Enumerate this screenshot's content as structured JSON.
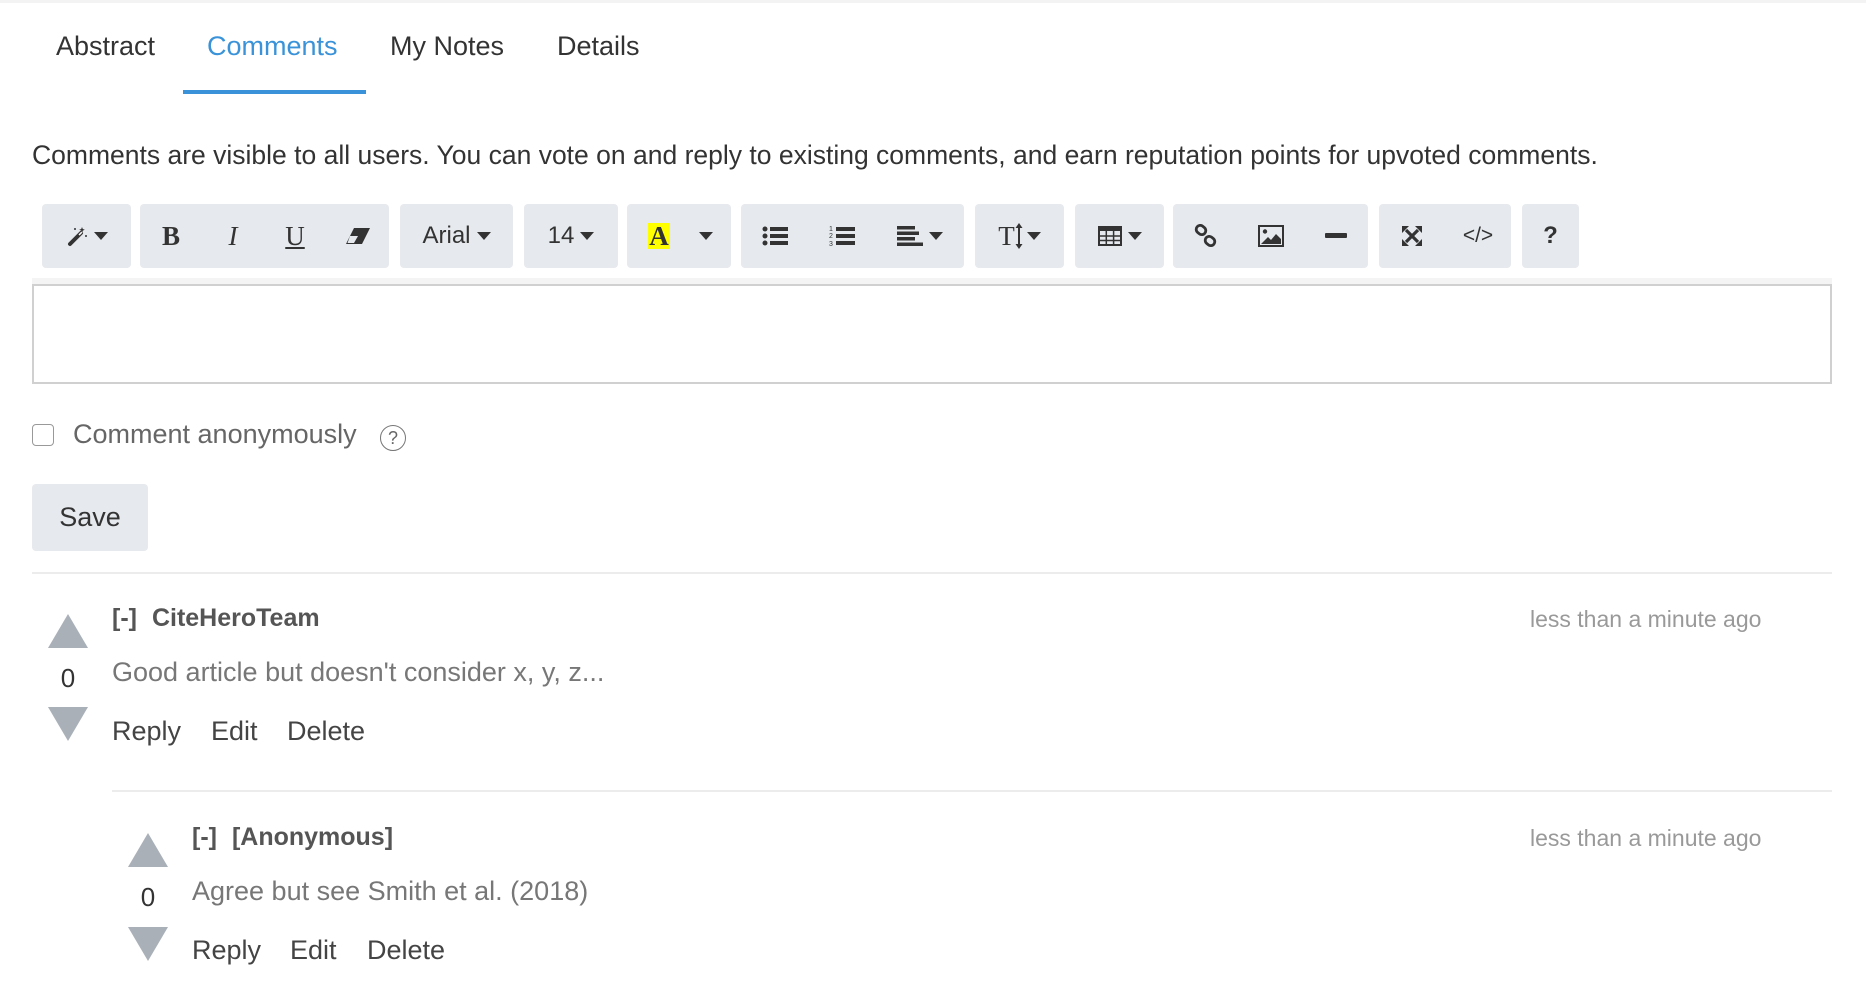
{
  "tabs": [
    {
      "label": "Abstract",
      "active": false
    },
    {
      "label": "Comments",
      "active": true
    },
    {
      "label": "My Notes",
      "active": false
    },
    {
      "label": "Details",
      "active": false
    }
  ],
  "accent_color": "#3a93d8",
  "description": "Comments are visible to all users. You can vote on and reply to existing comments, and earn reputation points for upvoted comments.",
  "toolbar": {
    "style_icon": "magic-wand-icon",
    "bold_label": "B",
    "italic_label": "I",
    "underline_label": "U",
    "eraser_icon": "eraser-icon",
    "font_family": "Arial",
    "font_size": "14",
    "color_label": "A",
    "highlight_color": "#ffff00",
    "unordered_list_icon": "list-ul-icon",
    "ordered_list_icon": "list-ol-icon",
    "align_icon": "align-left-icon",
    "line_height_label": "T",
    "table_icon": "table-icon",
    "link_icon": "link-icon",
    "picture_icon": "picture-icon",
    "hr_icon": "horizontal-rule-icon",
    "fullscreen_icon": "fullscreen-icon",
    "codeview_label": "</>",
    "help_label": "?"
  },
  "editor": {
    "value": ""
  },
  "anonymous": {
    "label": "Comment anonymously",
    "checked": false,
    "help": "?"
  },
  "save_label": "Save",
  "comments": [
    {
      "collapse": "[-]",
      "author": "CiteHeroTeam",
      "time": "less than a minute ago",
      "body": "Good article but doesn't consider x, y, z...",
      "votes": "0",
      "actions": [
        "Reply",
        "Edit",
        "Delete"
      ]
    },
    {
      "collapse": "[-]",
      "author": "[Anonymous]",
      "time": "less than a minute ago",
      "body": "Agree but see Smith et al. (2018)",
      "votes": "0",
      "actions": [
        "Reply",
        "Edit",
        "Delete"
      ]
    }
  ]
}
